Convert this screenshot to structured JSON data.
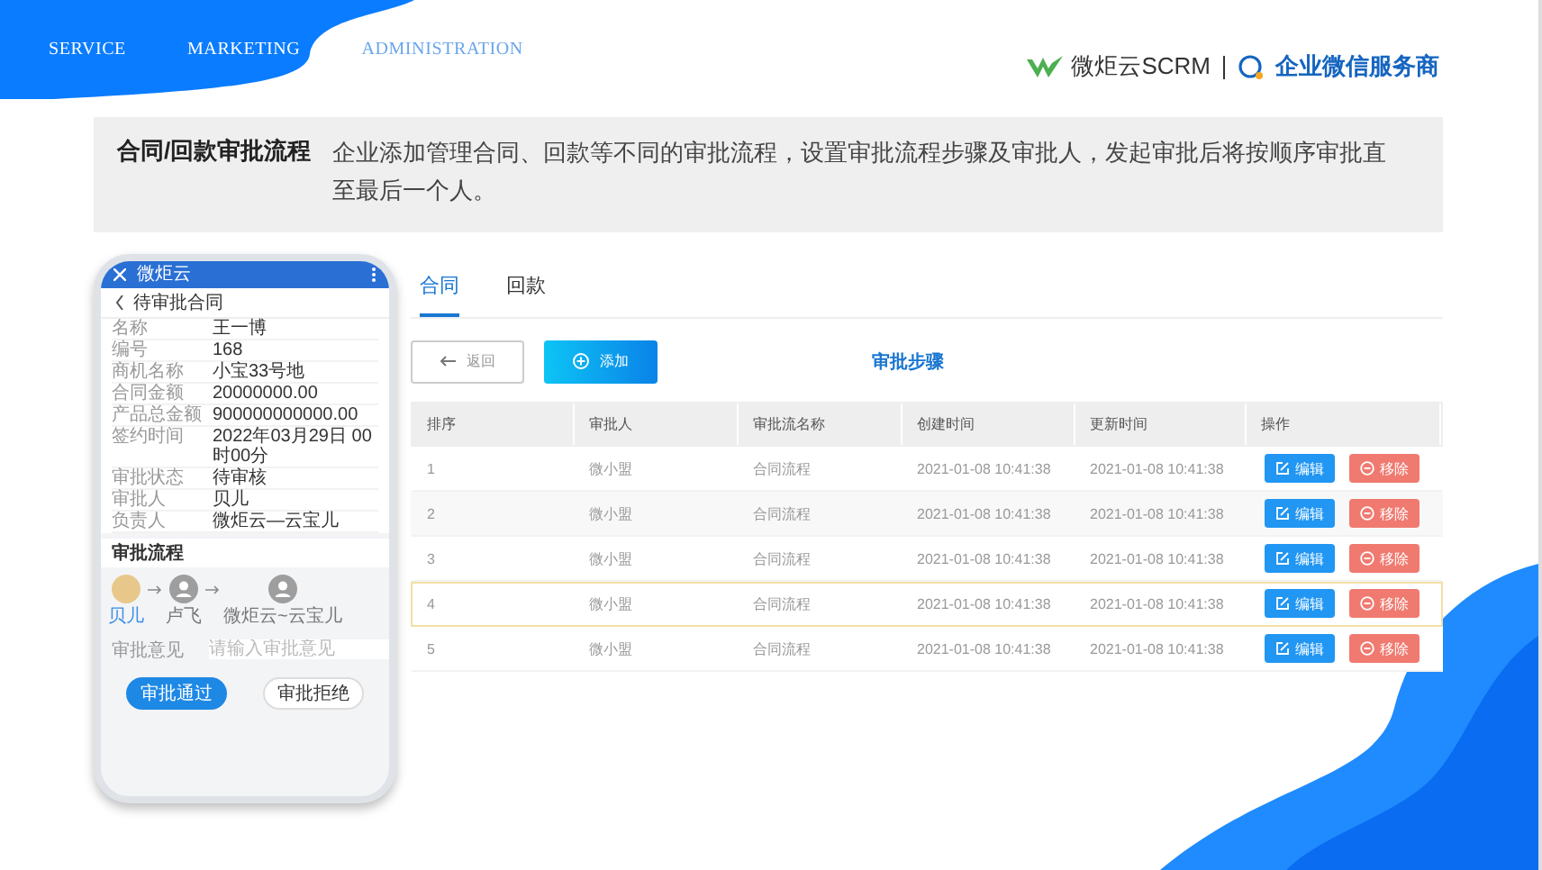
{
  "nav": [
    {
      "label": "SERVICE",
      "selected": false
    },
    {
      "label": "MARKETING",
      "selected": false
    },
    {
      "label": "ADMINISTRATION",
      "selected": true
    }
  ],
  "logo": {
    "brand": "微炬云SCRM",
    "tagline": "企业微信服务商"
  },
  "banner": {
    "title": "合同/回款审批流程",
    "description": "企业添加管理合同、回款等不同的审批流程，设置审批流程步骤及审批人，发起审批后将按顺序审批直至最后一个人。"
  },
  "phone": {
    "app_title": "微炬云",
    "page_title": "待审批合同",
    "fields": [
      {
        "label": "名称",
        "value": "王一博"
      },
      {
        "label": "编号",
        "value": "168"
      },
      {
        "label": "商机名称",
        "value": "小宝33号地"
      },
      {
        "label": "合同金额",
        "value": "20000000.00"
      },
      {
        "label": "产品总金额",
        "value": "900000000000.00"
      },
      {
        "label": "签约时间",
        "value": "2022年03月29日 00时00分"
      },
      {
        "label": "审批状态",
        "value": "待审核"
      },
      {
        "label": "审批人",
        "value": "贝儿"
      },
      {
        "label": "负责人",
        "value": "微炬云—云宝儿"
      }
    ],
    "flow_title": "审批流程",
    "flow": [
      {
        "name": "贝儿",
        "kind": "photo"
      },
      {
        "name": "卢飞",
        "kind": "default"
      },
      {
        "name": "微炬云~云宝儿",
        "kind": "default"
      }
    ],
    "opinion": {
      "label": "审批意见",
      "placeholder": "请输入审批意见"
    },
    "buttons": [
      {
        "label": "审批通过",
        "kind": "primary"
      },
      {
        "label": "审批拒绝",
        "kind": "plain"
      }
    ]
  },
  "tabs": [
    {
      "label": "合同",
      "selected": true
    },
    {
      "label": "回款",
      "selected": false
    }
  ],
  "toolbar": {
    "back": "返回",
    "add": "添加",
    "title": "审批步骤"
  },
  "table": {
    "columns": [
      "排序",
      "审批人",
      "审批流名称",
      "创建时间",
      "更新时间",
      "操作"
    ],
    "rows": [
      {
        "cells": [
          "1",
          "微小盟",
          "合同流程",
          "2021-01-08 10:41:38",
          "2021-01-08 10:41:38"
        ],
        "actions": [
          "编辑",
          "移除"
        ],
        "selected": false
      },
      {
        "cells": [
          "2",
          "微小盟",
          "合同流程",
          "2021-01-08 10:41:38",
          "2021-01-08 10:41:38"
        ],
        "actions": [
          "编辑",
          "移除"
        ],
        "selected": false
      },
      {
        "cells": [
          "3",
          "微小盟",
          "合同流程",
          "2021-01-08 10:41:38",
          "2021-01-08 10:41:38"
        ],
        "actions": [
          "编辑",
          "移除"
        ],
        "selected": false
      },
      {
        "cells": [
          "4",
          "微小盟",
          "合同流程",
          "2021-01-08 10:41:38",
          "2021-01-08 10:41:38"
        ],
        "actions": [
          "编辑",
          "移除"
        ],
        "selected": true
      },
      {
        "cells": [
          "5",
          "微小盟",
          "合同流程",
          "2021-01-08 10:41:38",
          "2021-01-08 10:41:38"
        ],
        "actions": [
          "编辑",
          "移除"
        ],
        "selected": false
      }
    ]
  }
}
